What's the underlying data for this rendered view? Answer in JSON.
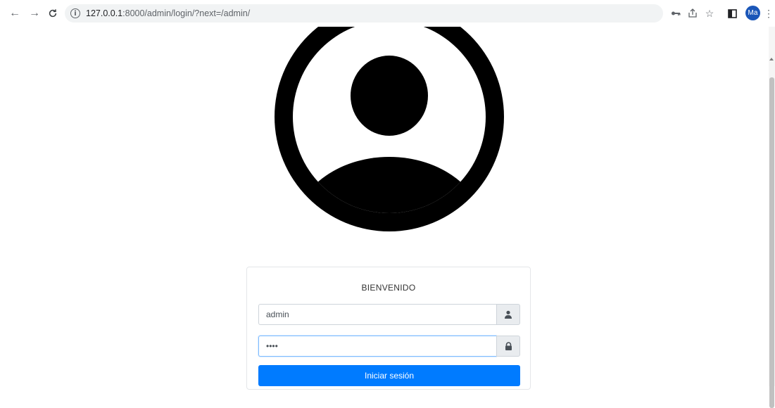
{
  "browser": {
    "url_host": "127.0.0.1",
    "url_path": ":8000/admin/login/?next=/admin/",
    "profile_initials": "Ma",
    "icons": [
      "back-arrow-icon",
      "forward-arrow-icon",
      "reload-icon",
      "info-icon",
      "key-icon",
      "share-icon",
      "star-icon",
      "sidepanel-icon",
      "menu-dots-icon"
    ]
  },
  "login": {
    "title": "BIENVENIDO",
    "username_value": "admin",
    "password_value": "••••",
    "submit_label": "Iniciar sesión"
  },
  "colors": {
    "primary": "#007bff",
    "profile": "#1a56b8"
  }
}
